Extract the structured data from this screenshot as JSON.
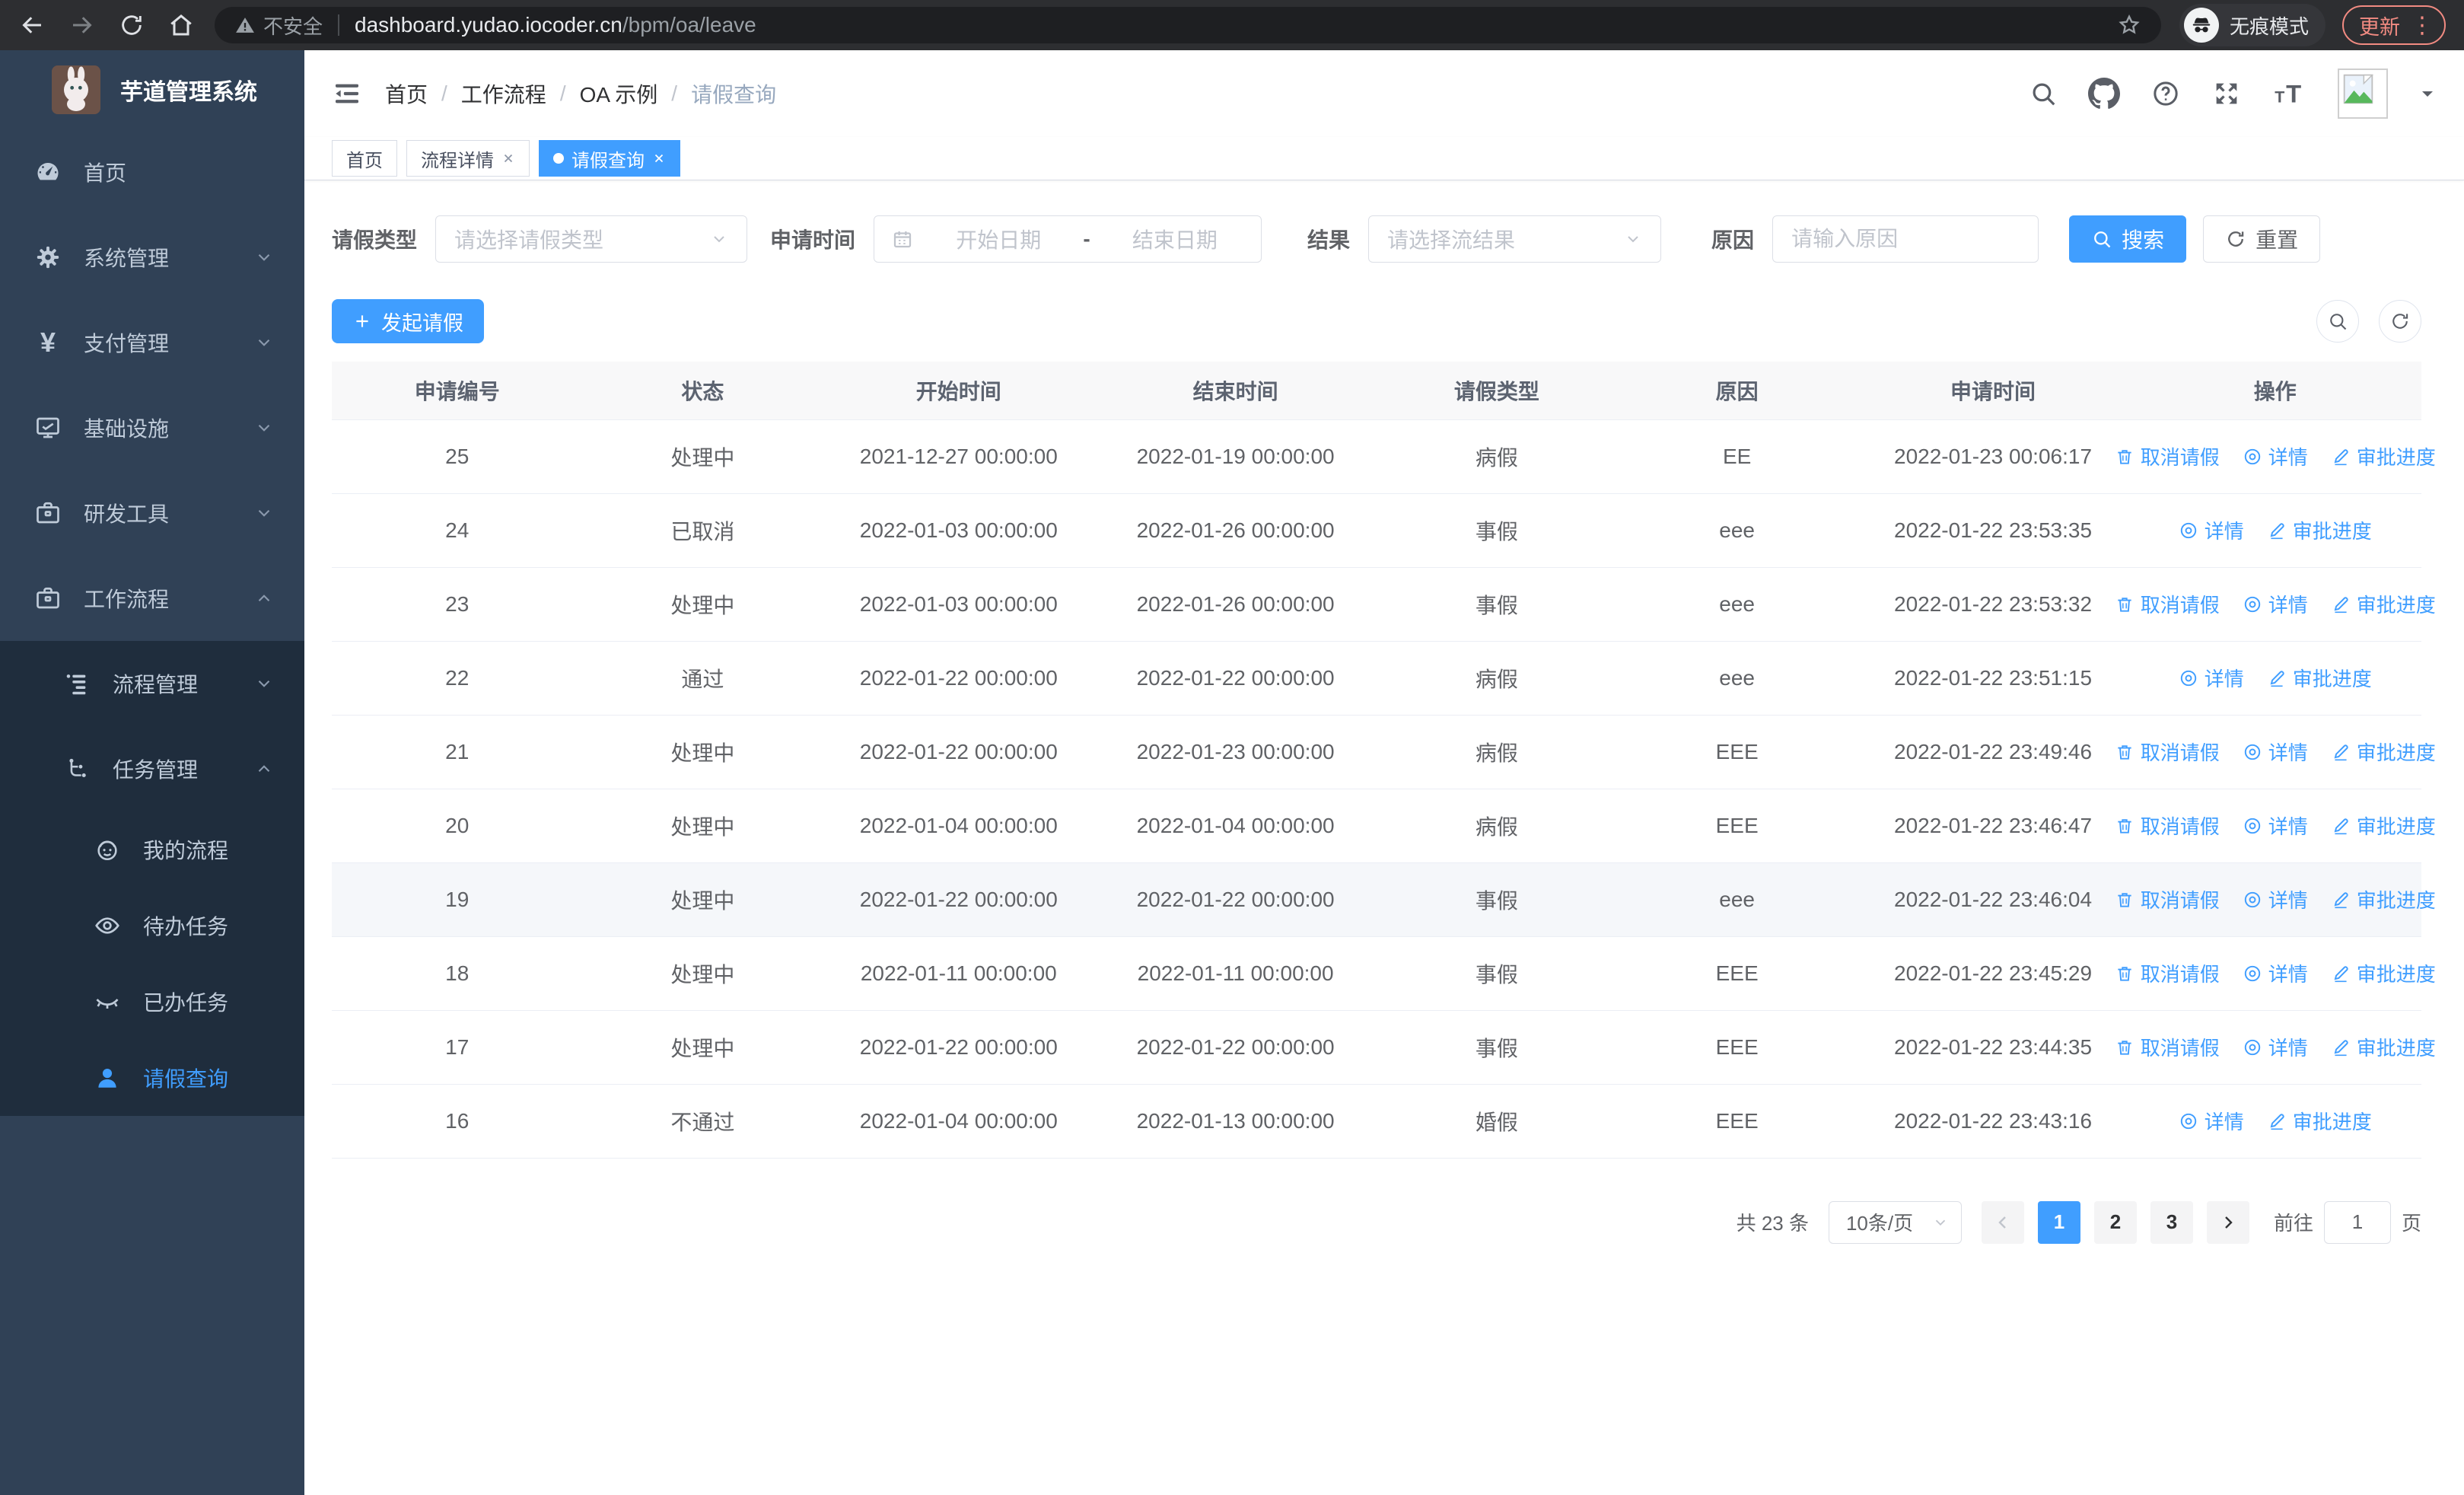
{
  "browser": {
    "security_label": "不安全",
    "url_host": "dashboard.yudao.iocoder.cn",
    "url_path": "/bpm/oa/leave",
    "incognito_label": "无痕模式",
    "update_label": "更新",
    "menu_dots": "⋮",
    "icons": [
      "back-icon",
      "forward-icon",
      "reload-icon",
      "home-icon",
      "warning-icon",
      "star-icon",
      "incognito-icon"
    ]
  },
  "sidebar": {
    "title": "芋道管理系统",
    "menu": [
      {
        "label": "首页",
        "icon": "dashboard-icon"
      },
      {
        "label": "系统管理",
        "icon": "gear-icon",
        "chevron": "down"
      },
      {
        "label": "支付管理",
        "icon": "yen-icon",
        "chevron": "down"
      },
      {
        "label": "基础设施",
        "icon": "monitor-icon",
        "chevron": "down"
      },
      {
        "label": "研发工具",
        "icon": "toolbox-icon",
        "chevron": "down"
      },
      {
        "label": "工作流程",
        "icon": "briefcase-icon",
        "chevron": "up"
      }
    ],
    "submenu": [
      {
        "label": "流程管理",
        "icon": "list-icon",
        "chevron": "down"
      },
      {
        "label": "任务管理",
        "icon": "tree-icon",
        "chevron": "up"
      },
      {
        "label": "我的流程",
        "icon": "face-icon"
      },
      {
        "label": "待办任务",
        "icon": "eye-open-icon"
      },
      {
        "label": "已办任务",
        "icon": "eye-closed-icon"
      },
      {
        "label": "请假查询",
        "icon": "user-icon",
        "active": true
      }
    ]
  },
  "navbar": {
    "breadcrumb": [
      "首页",
      "工作流程",
      "OA 示例",
      "请假查询"
    ],
    "separator": "/",
    "icons": [
      "search-icon",
      "github-icon",
      "question-icon",
      "fullscreen-icon",
      "text-size-icon",
      "avatar",
      "caret-down-icon"
    ]
  },
  "tabs": [
    {
      "label": "首页",
      "closable": false,
      "active": false
    },
    {
      "label": "流程详情",
      "closable": true,
      "active": false
    },
    {
      "label": "请假查询",
      "closable": true,
      "active": true
    }
  ],
  "filters": {
    "leave_type_label": "请假类型",
    "leave_type_placeholder": "请选择请假类型",
    "apply_time_label": "申请时间",
    "date_start_placeholder": "开始日期",
    "date_separator": "-",
    "date_end_placeholder": "结束日期",
    "result_label": "结果",
    "result_placeholder": "请选择流结果",
    "reason_label": "原因",
    "reason_placeholder": "请输入原因",
    "search_label": "搜索",
    "reset_label": "重置"
  },
  "toolbar": {
    "create_label": "发起请假"
  },
  "table": {
    "columns": [
      "申请编号",
      "状态",
      "开始时间",
      "结束时间",
      "请假类型",
      "原因",
      "申请时间",
      "操作"
    ],
    "actions": {
      "cancel": "取消请假",
      "detail": "详情",
      "progress": "审批进度"
    },
    "rows": [
      {
        "id": "25",
        "status": "处理中",
        "start": "2021-12-27 00:00:00",
        "end": "2022-01-19 00:00:00",
        "type": "病假",
        "reason": "EE",
        "applied": "2022-01-23 00:06:17"
      },
      {
        "id": "24",
        "status": "已取消",
        "start": "2022-01-03 00:00:00",
        "end": "2022-01-26 00:00:00",
        "type": "事假",
        "reason": "eee",
        "applied": "2022-01-22 23:53:35"
      },
      {
        "id": "23",
        "status": "处理中",
        "start": "2022-01-03 00:00:00",
        "end": "2022-01-26 00:00:00",
        "type": "事假",
        "reason": "eee",
        "applied": "2022-01-22 23:53:32"
      },
      {
        "id": "22",
        "status": "通过",
        "start": "2022-01-22 00:00:00",
        "end": "2022-01-22 00:00:00",
        "type": "病假",
        "reason": "eee",
        "applied": "2022-01-22 23:51:15"
      },
      {
        "id": "21",
        "status": "处理中",
        "start": "2022-01-22 00:00:00",
        "end": "2022-01-23 00:00:00",
        "type": "病假",
        "reason": "EEE",
        "applied": "2022-01-22 23:49:46"
      },
      {
        "id": "20",
        "status": "处理中",
        "start": "2022-01-04 00:00:00",
        "end": "2022-01-04 00:00:00",
        "type": "病假",
        "reason": "EEE",
        "applied": "2022-01-22 23:46:47"
      },
      {
        "id": "19",
        "status": "处理中",
        "start": "2022-01-22 00:00:00",
        "end": "2022-01-22 00:00:00",
        "type": "事假",
        "reason": "eee",
        "applied": "2022-01-22 23:46:04"
      },
      {
        "id": "18",
        "status": "处理中",
        "start": "2022-01-11 00:00:00",
        "end": "2022-01-11 00:00:00",
        "type": "事假",
        "reason": "EEE",
        "applied": "2022-01-22 23:45:29"
      },
      {
        "id": "17",
        "status": "处理中",
        "start": "2022-01-22 00:00:00",
        "end": "2022-01-22 00:00:00",
        "type": "事假",
        "reason": "EEE",
        "applied": "2022-01-22 23:44:35"
      },
      {
        "id": "16",
        "status": "不通过",
        "start": "2022-01-04 00:00:00",
        "end": "2022-01-13 00:00:00",
        "type": "婚假",
        "reason": "EEE",
        "applied": "2022-01-22 23:43:16"
      }
    ]
  },
  "pagination": {
    "total": "共 23 条",
    "page_size": "10条/页",
    "pages": [
      "1",
      "2",
      "3"
    ],
    "current": "1",
    "goto_label": "前往",
    "goto_value": "1",
    "page_unit": "页"
  },
  "colors": {
    "accent": "#409eff",
    "sidebar_bg": "#304156",
    "submenu_bg": "#1f2d3d"
  }
}
